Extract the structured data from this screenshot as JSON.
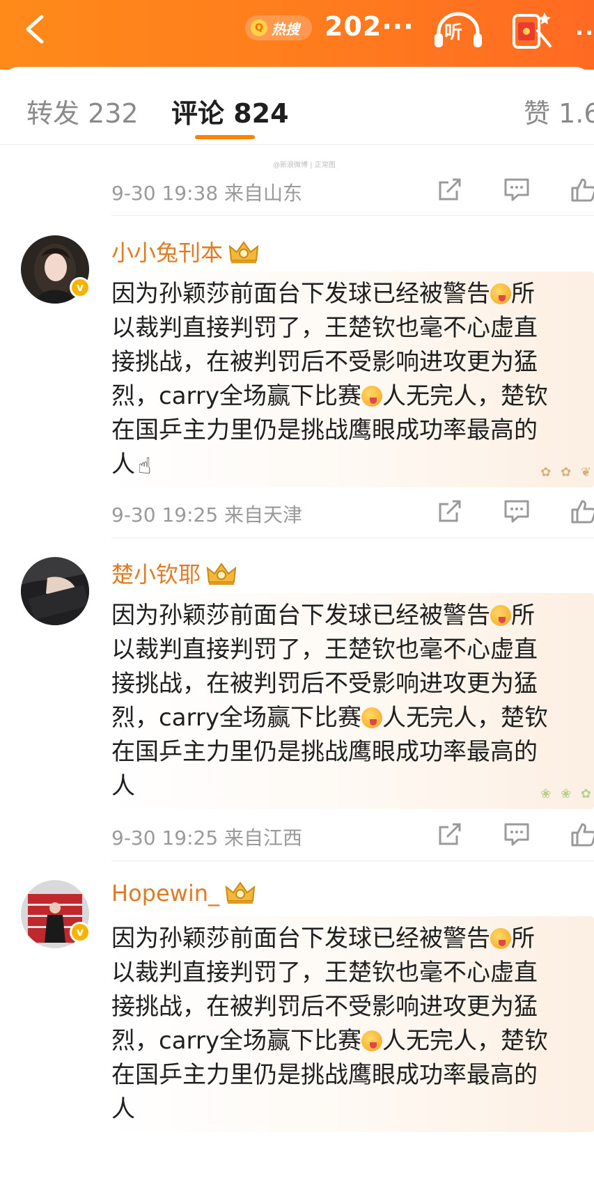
{
  "header": {
    "back_icon": "chevron-left-icon",
    "hot_search_label": "热搜",
    "topic_title": "202···",
    "listen_label": "听",
    "more_label": "··"
  },
  "tabs": [
    {
      "label": "转发 232"
    },
    {
      "label": "评论 824",
      "active": true
    },
    {
      "label": "赞 1.6"
    }
  ],
  "watermark": "@新浪微博  |  正常图",
  "first_meta": {
    "time": "9-30 19:38",
    "source": "来自山东"
  },
  "comments": [
    {
      "username": "小小兔刊本",
      "verified": true,
      "lines": [
        "因为孙颖莎前面台下发球已经被警告",
        "所",
        "以裁判直接判罚了，王楚钦也毫不心虚直",
        "接挑战，在被判罚后不受影响进攻更为猛",
        "烈，carry全场赢下比赛",
        "人无完人，楚钦",
        "在国乒主力里仍是挑战鹰眼成功率最高的",
        "人"
      ],
      "meta": {
        "time": "9-30 19:25",
        "source": "来自天津"
      }
    },
    {
      "username": "楚小钦耶",
      "verified": false,
      "lines": [
        "因为孙颖莎前面台下发球已经被警告",
        "所",
        "以裁判直接判罚了，王楚钦也毫不心虚直",
        "接挑战，在被判罚后不受影响进攻更为猛",
        "烈，carry全场赢下比赛",
        "人无完人，楚钦",
        "在国乒主力里仍是挑战鹰眼成功率最高的",
        "人"
      ],
      "meta": {
        "time": "9-30 19:25",
        "source": "来自江西"
      }
    },
    {
      "username": "Hopewin_",
      "verified": true,
      "lines": [
        "因为孙颖莎前面台下发球已经被警告",
        "所",
        "以裁判直接判罚了，王楚钦也毫不心虚直",
        "接挑战，在被判罚后不受影响进攻更为猛",
        "烈，carry全场赢下比赛",
        "人无完人，楚钦",
        "在国乒主力里仍是挑战鹰眼成功率最高的",
        "人"
      ]
    }
  ],
  "icons": {
    "share": "share-icon",
    "reply": "comment-icon",
    "like": "thumbs-up-icon",
    "verified": "verified-badge-icon",
    "crown": "crown-icon"
  },
  "colors": {
    "header_orange": "#ff7a1e",
    "username_orange": "#e17a22",
    "tab_indicator": "#ff8200",
    "meta_gray": "#9a9a9a",
    "verified_gold": "#f6b400"
  }
}
